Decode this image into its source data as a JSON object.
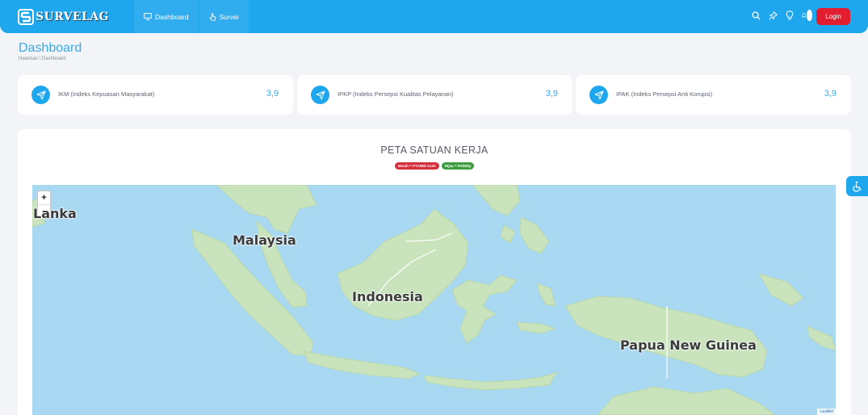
{
  "app": {
    "logo_text": "SURVELAG"
  },
  "nav": [
    {
      "label": "Dashboard",
      "icon": "monitor-icon"
    },
    {
      "label": "Survei",
      "icon": "hand-pointer-icon"
    }
  ],
  "toolbar": {
    "icons": [
      "search-icon",
      "pin-icon",
      "lightbulb-icon",
      "bell-icon"
    ],
    "login_label": "Login"
  },
  "header": {
    "title": "Dashboard",
    "breadcrumb": "Halaman \\ Dashboard"
  },
  "stats": [
    {
      "label": "IKM (Indeks Kepuasan Masyarakat)",
      "value": "3,9",
      "icon": "send-icon"
    },
    {
      "label": "IPKP (Indeks Persepsi Kualitas Pelayanan)",
      "value": "3,9",
      "icon": "send-icon"
    },
    {
      "label": "IPAK (Indeks Persepsi Anti Korupsi)",
      "value": "3,9",
      "icon": "send-icon"
    }
  ],
  "map_section": {
    "title": "PETA SATUAN KERJA",
    "legend": [
      {
        "label": "Merah = PTA/MS Aceh",
        "color": "#d32f3c"
      },
      {
        "label": "Hijau = PA/MSy",
        "color": "#3d9b40"
      }
    ],
    "labels": [
      "Lanka",
      "Malaysia",
      "Indonesia",
      "Papua New Guinea"
    ],
    "zoom_in": "+",
    "zoom_out": "−",
    "attribution": "Leaflet"
  },
  "colors": {
    "primary": "#1fa7ee",
    "danger": "#e11d2f",
    "water": "#a9d8f2",
    "land": "#c9e3bd"
  }
}
